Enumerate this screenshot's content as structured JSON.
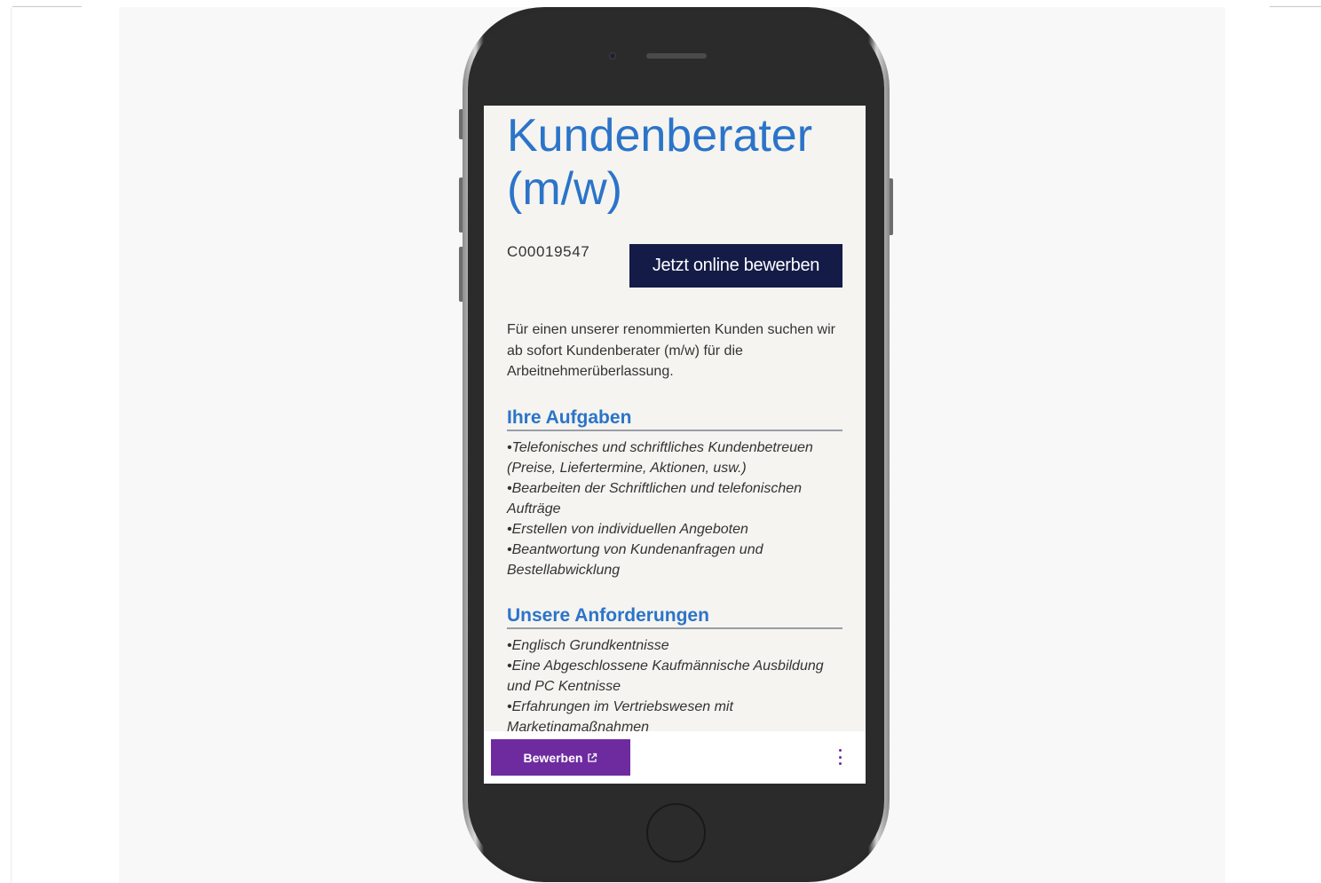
{
  "job": {
    "title": "Kundenberater (m/w)",
    "reference": "C00019547",
    "apply_label": "Jetzt online bewerben",
    "intro": "Für einen unserer renommierten Kunden suchen wir ab sofort Kundenberater (m/w) für die Arbeitnehmerüberlassung."
  },
  "sections": [
    {
      "heading": "Ihre Aufgaben",
      "items": [
        "•Telefonisches und schriftliches Kundenbetreuen (Preise, Liefertermine, Aktionen, usw.)",
        "•Bearbeiten der Schriftlichen und telefonischen Aufträge",
        "•Erstellen von individuellen Angeboten",
        "•Beantwortung von Kundenanfragen und Bestellabwicklung"
      ]
    },
    {
      "heading": "Unsere Anforderungen",
      "items": [
        "•Englisch Grundkentnisse",
        "•Eine Abgeschlossene Kaufmännische Ausbildung und PC Kentnisse",
        "•Erfahrungen im Vertriebswesen mit Marketingmaßnahmen"
      ]
    }
  ],
  "bottom_bar": {
    "apply_label": "Bewerben",
    "apply_icon": "external-link-icon",
    "menu_icon": "more-vertical-icon",
    "accent_color": "#6e2ba0"
  },
  "colors": {
    "title": "#2b74c9",
    "apply_button": "#141b47",
    "screen_background": "#f5f4f0"
  }
}
